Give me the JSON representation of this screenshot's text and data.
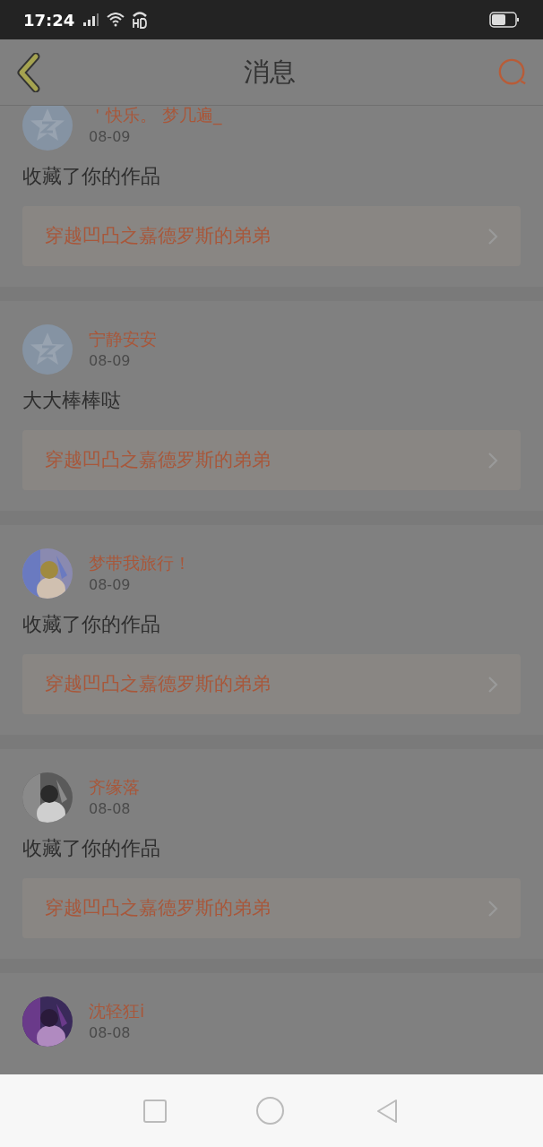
{
  "status_bar": {
    "time": "17:24"
  },
  "header": {
    "title": "消息"
  },
  "messages": [
    {
      "name": "＇快乐。 梦几遍_",
      "date": "08-09",
      "avatar": {
        "kind": "default"
      },
      "text": "收藏了你的作品",
      "work": "穿越凹凸之嘉德罗斯的弟弟"
    },
    {
      "name": "宁静安安",
      "date": "08-09",
      "avatar": {
        "kind": "default"
      },
      "text": "大大棒棒哒",
      "work": "穿越凹凸之嘉德罗斯的弟弟"
    },
    {
      "name": "梦带我旅行！",
      "date": "08-09",
      "text": "收藏了你的作品",
      "work": "穿越凹凸之嘉德罗斯的弟弟"
    },
    {
      "name": "齐缘落",
      "date": "08-08",
      "text": "收藏了你的作品",
      "work": "穿越凹凸之嘉德罗斯的弟弟"
    },
    {
      "name": "沈轻狂i",
      "date": "08-08"
    }
  ]
}
